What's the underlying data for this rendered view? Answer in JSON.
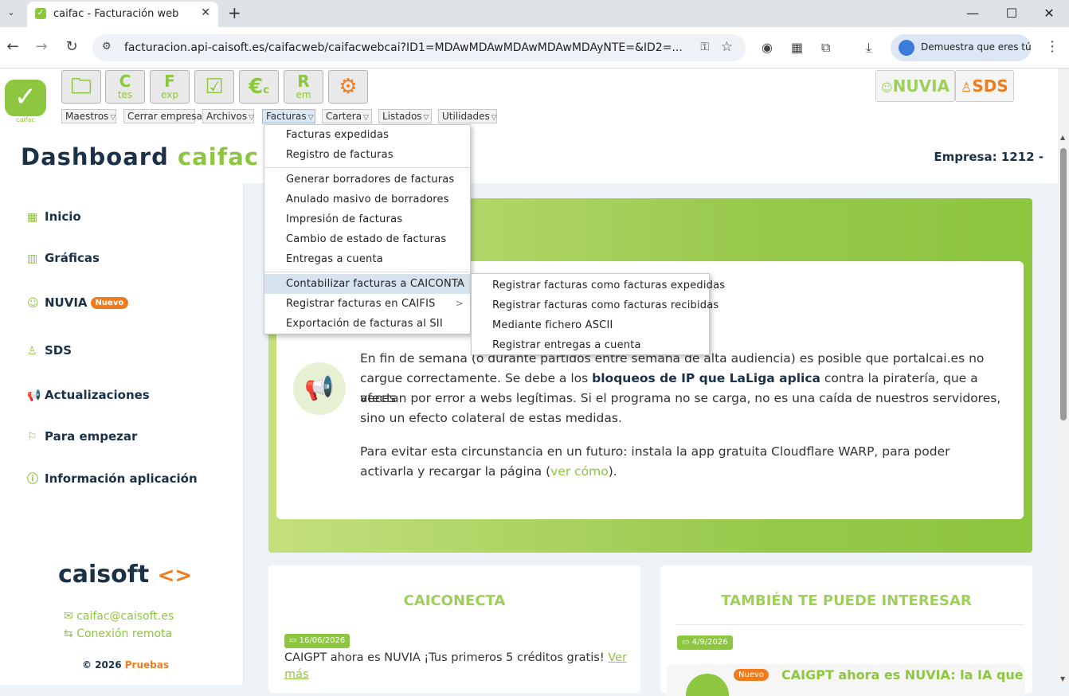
{
  "browser": {
    "tab_title": "caifac - Facturación web",
    "url": "facturacion.api-caisoft.es/caifacweb/caifacwebcai?ID1=MDAwMDAwMDAwMDAwMDAyNTE=&ID2=...",
    "profile_label": "Demuestra que eres tú"
  },
  "app": {
    "logo_label": "caifac",
    "quick_buttons": [
      {
        "big": "C",
        "small": "tes"
      },
      {
        "big": "F",
        "small": "exp"
      },
      {
        "big": "R",
        "small": "em"
      }
    ],
    "euro_symbol": "€",
    "euro_sub": "c",
    "menu": [
      "Maestros",
      "Cerrar empresa",
      "Archivos",
      "Facturas",
      "Cartera",
      "Listados",
      "Utilidades"
    ],
    "nuvia_label": "NUVIA",
    "sds_label": "SDS",
    "title_main": "Dashboard ",
    "title_accent": "caifac",
    "empresa": "Empresa: 1212 -"
  },
  "dropdown": {
    "items": [
      "Facturas expedidas",
      "Registro de facturas",
      "Generar borradores de facturas",
      "Anulado masivo de borradores",
      "Impresión de facturas",
      "Cambio de estado de facturas",
      "Entregas a cuenta",
      "Contabilizar facturas a CAICONTA",
      "Registrar facturas en CAIFIS",
      "Exportación de facturas al SII"
    ],
    "submenu": [
      "Registrar facturas como facturas expedidas",
      "Registrar facturas como facturas recibidas",
      "Mediante fichero ASCII",
      "Registrar entregas a cuenta"
    ]
  },
  "sidebar": {
    "items": [
      "Inicio",
      "Gráficas",
      "NUVIA",
      "SDS",
      "Actualizaciones",
      "Para empezar",
      "Información aplicación"
    ],
    "nuevo_badge": "Nuevo",
    "brand": "caisoft",
    "email": "caifac@caisoft.es",
    "remote": "Conexión remota",
    "copyright": "© 2026 ",
    "copyright_link": "Pruebas"
  },
  "notice": {
    "line1": "En fin de semana (o durante partidos entre semana de alta audiencia) es posible que portalcai.es no",
    "line2_pre": "cargue correctamente. Se debe a los ",
    "line2_bold": "bloqueos de IP que LaLiga aplica",
    "line2_post": " contra la piratería, que a veces",
    "line3": "afectan por error a webs legítimas. Si el programa no se carga, no es una caída de nuestros servidores,",
    "line4": "sino un efecto colateral de estas medidas.",
    "line5": "Para evitar esta circunstancia en un futuro: instala la app gratuita Cloudflare WARP, para poder",
    "line6_pre": "activarla y recargar la página (",
    "line6_link": "ver cómo",
    "line6_post": ")."
  },
  "caiconecta": {
    "title": "CAICONECTA",
    "date": "16/06/2026",
    "text": "CAIGPT ahora es NUVIA ¡Tus primeros 5 créditos gratis! ",
    "link": "Ver más"
  },
  "interesar": {
    "title": "TAMBIÉN TE PUEDE INTERESAR",
    "date": "4/9/2026",
    "badge": "Nuevo",
    "headline": "CAIGPT ahora es NUVIA: la IA que"
  }
}
